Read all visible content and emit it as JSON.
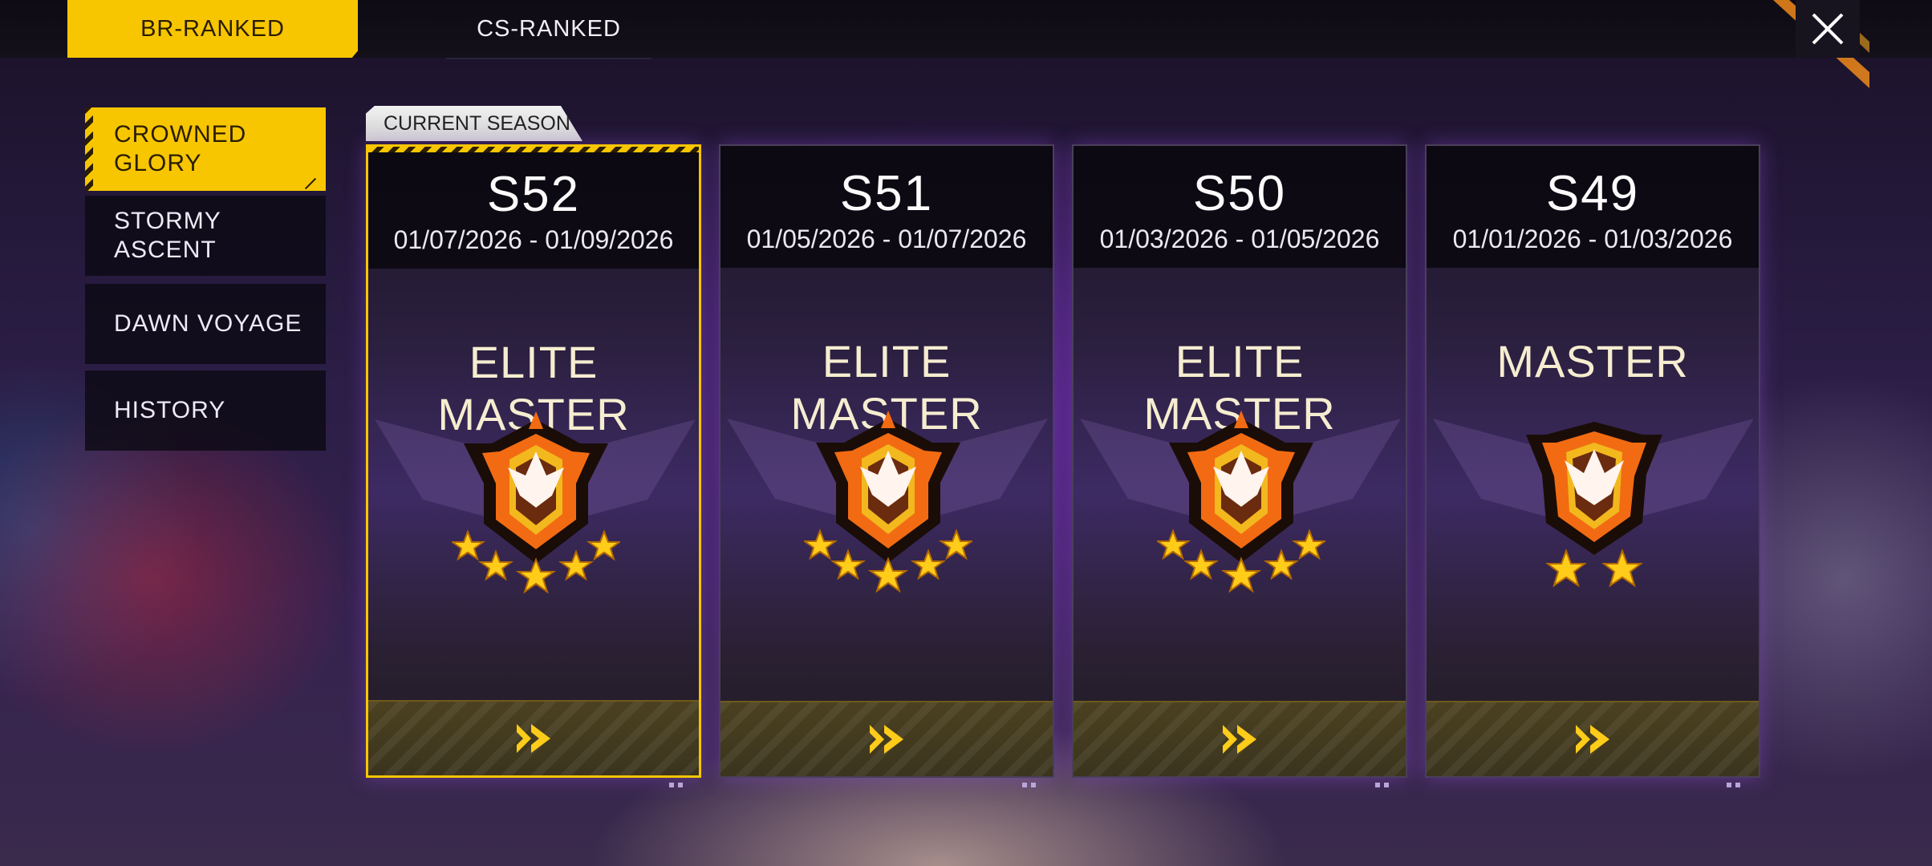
{
  "tabs": [
    {
      "label": "BR-RANKED",
      "active": true
    },
    {
      "label": "CS-RANKED",
      "active": false
    }
  ],
  "sidebar": {
    "items": [
      {
        "label": "CROWNED\nGLORY",
        "active": true
      },
      {
        "label": "STORMY\nASCENT",
        "active": false
      },
      {
        "label": "DAWN VOYAGE",
        "active": false
      },
      {
        "label": "HISTORY",
        "active": false
      }
    ]
  },
  "current_season_tag": "CURRENT SEASON",
  "cards": [
    {
      "season": "S52",
      "dates": "01/07/2026 - 01/09/2026",
      "rank": "ELITE MASTER",
      "stars": 5
    },
    {
      "season": "S51",
      "dates": "01/05/2026 - 01/07/2026",
      "rank": "ELITE MASTER",
      "stars": 5
    },
    {
      "season": "S50",
      "dates": "01/03/2026 - 01/05/2026",
      "rank": "ELITE MASTER",
      "stars": 5
    },
    {
      "season": "S49",
      "dates": "01/01/2026 - 01/03/2026",
      "rank": "MASTER",
      "stars": 2
    }
  ],
  "colors": {
    "accent": "#f7c600",
    "badge_orange": "#f26b12",
    "badge_gold": "#f2b81e",
    "star": "#ffcc1a"
  }
}
